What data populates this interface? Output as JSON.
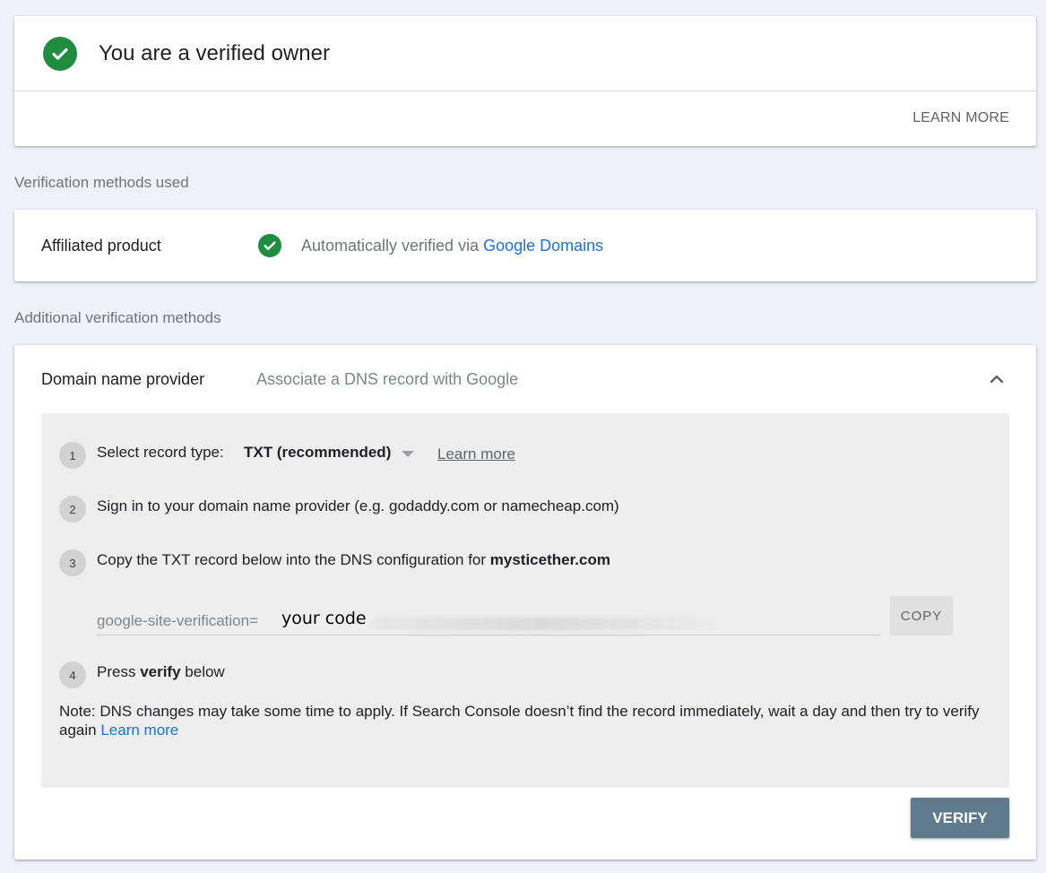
{
  "owner": {
    "title": "You are a verified owner",
    "learn_more": "LEARN MORE"
  },
  "sections": {
    "used": "Verification methods used",
    "additional": "Additional verification methods"
  },
  "affiliated": {
    "name": "Affiliated product",
    "desc": "Automatically verified via ",
    "link": "Google Domains"
  },
  "dns": {
    "name": "Domain name provider",
    "desc": "Associate a DNS record with Google",
    "steps": [
      {
        "num": "1",
        "text": "Select record type:",
        "select_value": "TXT (recommended)",
        "link": "Learn more"
      },
      {
        "num": "2",
        "text": "Sign in to your domain name provider (e.g. godaddy.com or namecheap.com)"
      },
      {
        "num": "3",
        "text": "Copy the TXT record below into the DNS configuration for ",
        "domain": "mysticether.com"
      },
      {
        "num": "4",
        "text_before": "Press ",
        "text_bold": "verify",
        "text_after": " below"
      }
    ],
    "record": {
      "prefix": "google-site-verification=",
      "code": "your code",
      "copy_label": "COPY"
    },
    "note": "Note: DNS changes may take some time to apply. If Search Console doesn’t find the record immediately, wait a day and then try to verify again ",
    "note_link": "Learn more",
    "verify_label": "VERIFY"
  },
  "colors": {
    "background": "#eef1f8",
    "success_green": "#1e8e3e",
    "link_blue": "#1a73e8",
    "verify_button": "#5f7a8c"
  },
  "icons": {
    "check": "check-circle-icon",
    "chevron": "chevron-up-icon",
    "caret": "caret-down-icon"
  }
}
